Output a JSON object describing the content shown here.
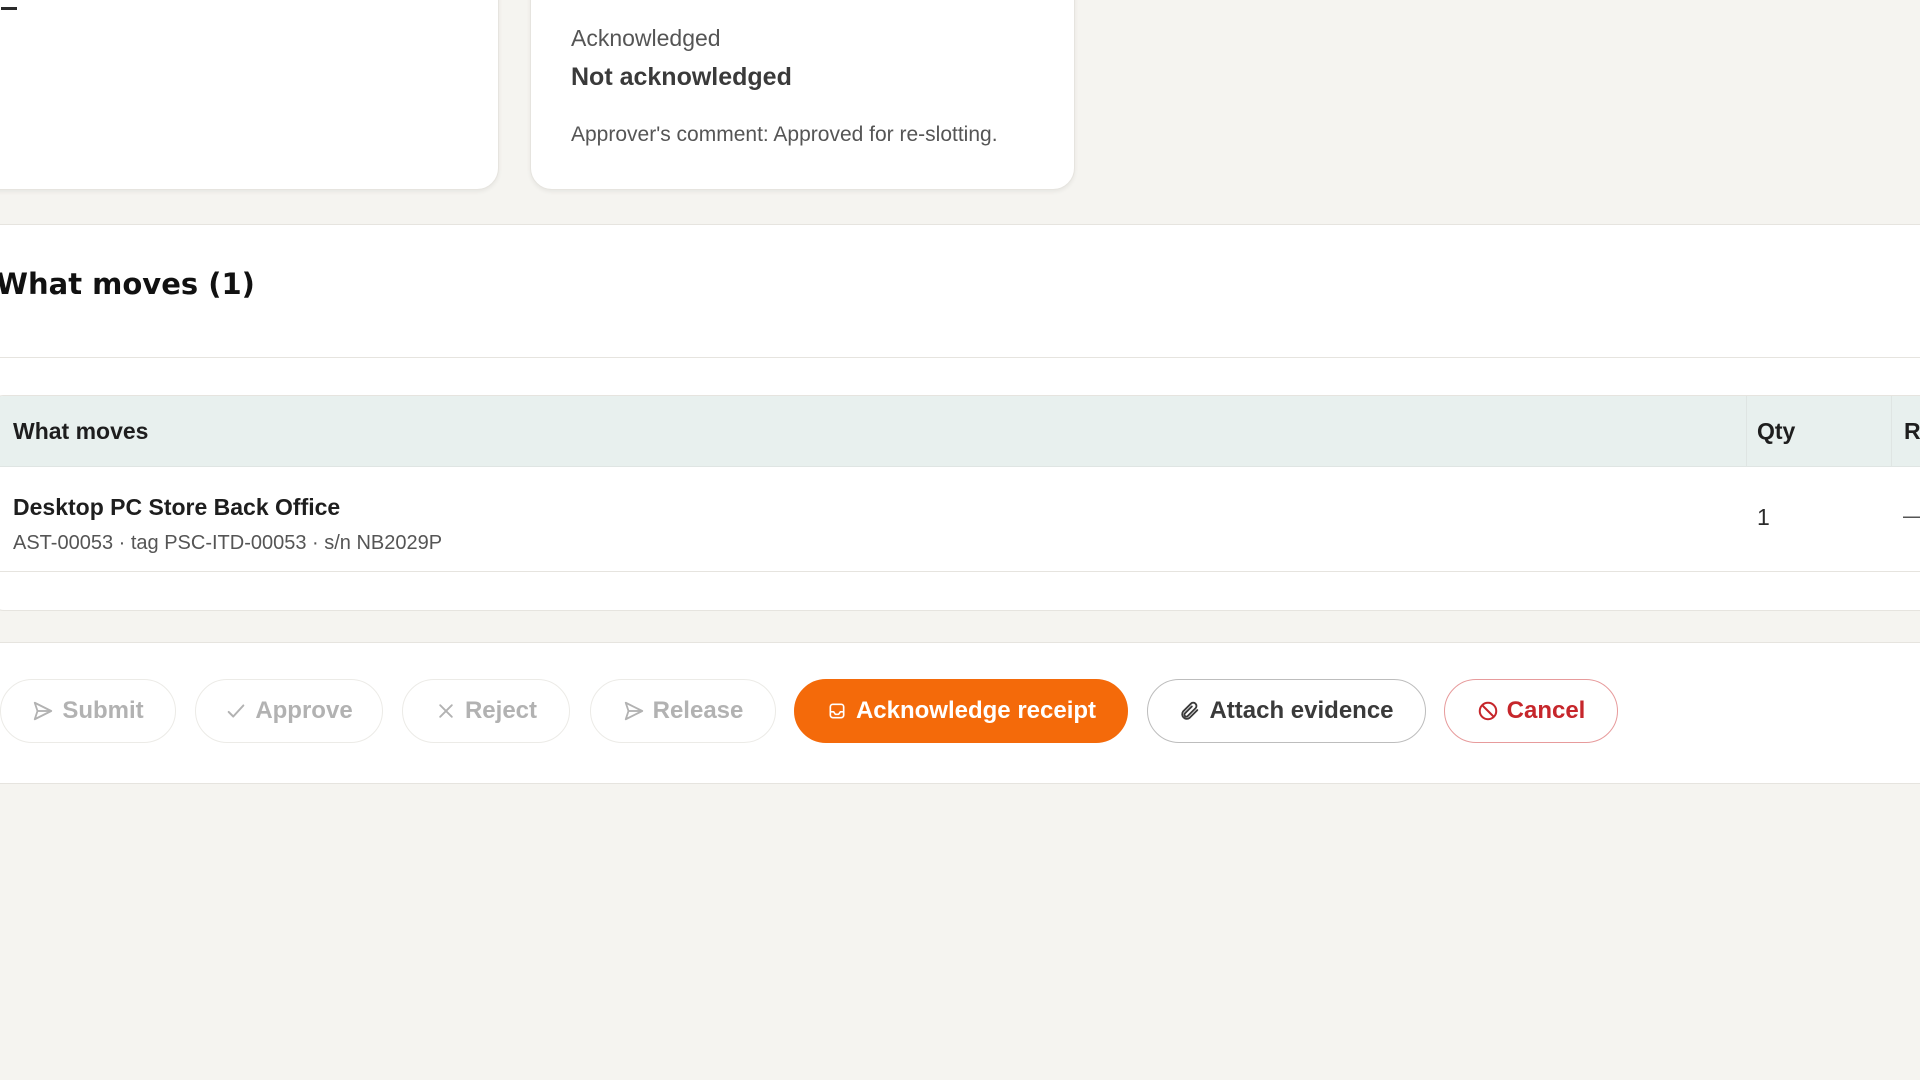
{
  "cards": {
    "left": {
      "value": "—"
    },
    "right": {
      "label": "Acknowledged",
      "value": "Not acknowledged",
      "comment": "Approver's comment: Approved for re-slotting."
    }
  },
  "section": {
    "title": "What moves (1)",
    "table": {
      "headers": {
        "what": "What moves",
        "qty": "Qty",
        "re": "Re"
      },
      "rows": [
        {
          "name": "Desktop PC Store Back Office",
          "meta": "AST-00053 · tag PSC-ITD-00053 · s/n NB2029P",
          "qty": "1",
          "rem": "—"
        }
      ]
    }
  },
  "actions": {
    "submit": {
      "label": "Submit",
      "icon": "send-icon"
    },
    "approve": {
      "label": "Approve",
      "icon": "check-icon"
    },
    "reject": {
      "label": "Reject",
      "icon": "x-icon"
    },
    "release": {
      "label": "Release",
      "icon": "send-icon"
    },
    "acknowledge": {
      "label": "Acknowledge receipt",
      "icon": "inbox-icon"
    },
    "attach": {
      "label": "Attach evidence",
      "icon": "paperclip-icon"
    },
    "cancel": {
      "label": "Cancel",
      "icon": "ban-icon"
    }
  },
  "colors": {
    "accent": "#f46a0a",
    "danger": "#c6262b",
    "header_bg": "#e8f0ee",
    "page_bg": "#f5f4f0"
  }
}
